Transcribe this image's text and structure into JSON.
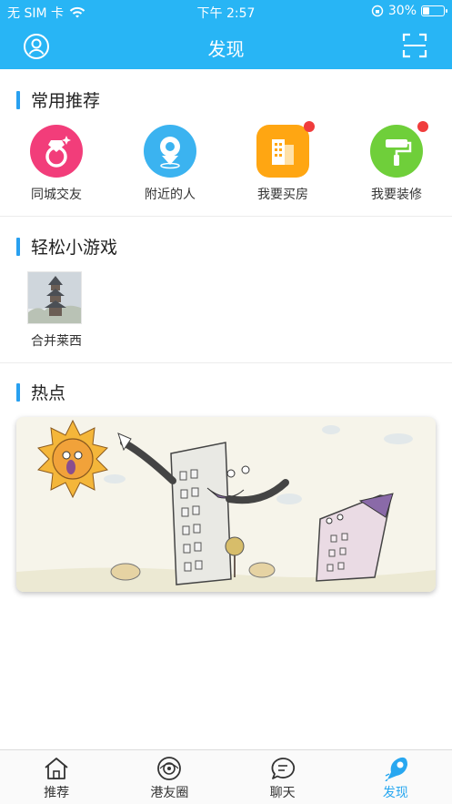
{
  "status_bar": {
    "carrier": "无 SIM 卡",
    "time": "下午 2:57",
    "battery": "30%",
    "battery_level": 0.3
  },
  "header": {
    "title": "发现",
    "left_icon": "avatar-icon",
    "right_icon": "scan-icon"
  },
  "sections": {
    "common": {
      "title": "常用推荐",
      "items": [
        {
          "label": "同城交友",
          "icon": "diamond-ring-icon",
          "color": "#f23d7a",
          "badge": false
        },
        {
          "label": "附近的人",
          "icon": "location-pin-icon",
          "color": "#3bb3f0",
          "badge": false
        },
        {
          "label": "我要买房",
          "icon": "building-icon",
          "color": "#ffa612",
          "badge": true
        },
        {
          "label": "我要装修",
          "icon": "paint-roller-icon",
          "color": "#6fcf3a",
          "badge": true
        }
      ]
    },
    "games": {
      "title": "轻松小游戏",
      "items": [
        {
          "label": "合并莱西"
        }
      ]
    },
    "hot": {
      "title": "热点"
    }
  },
  "tabbar": {
    "items": [
      {
        "label": "推荐",
        "icon": "home-icon",
        "active": false
      },
      {
        "label": "港友圈",
        "icon": "circle-icon",
        "active": false
      },
      {
        "label": "聊天",
        "icon": "chat-icon",
        "active": false
      },
      {
        "label": "发现",
        "icon": "discover-icon",
        "active": true
      }
    ]
  },
  "colors": {
    "primary": "#28b5f5",
    "accent_bar": "#28a0f0",
    "badge": "#f03c3c"
  }
}
